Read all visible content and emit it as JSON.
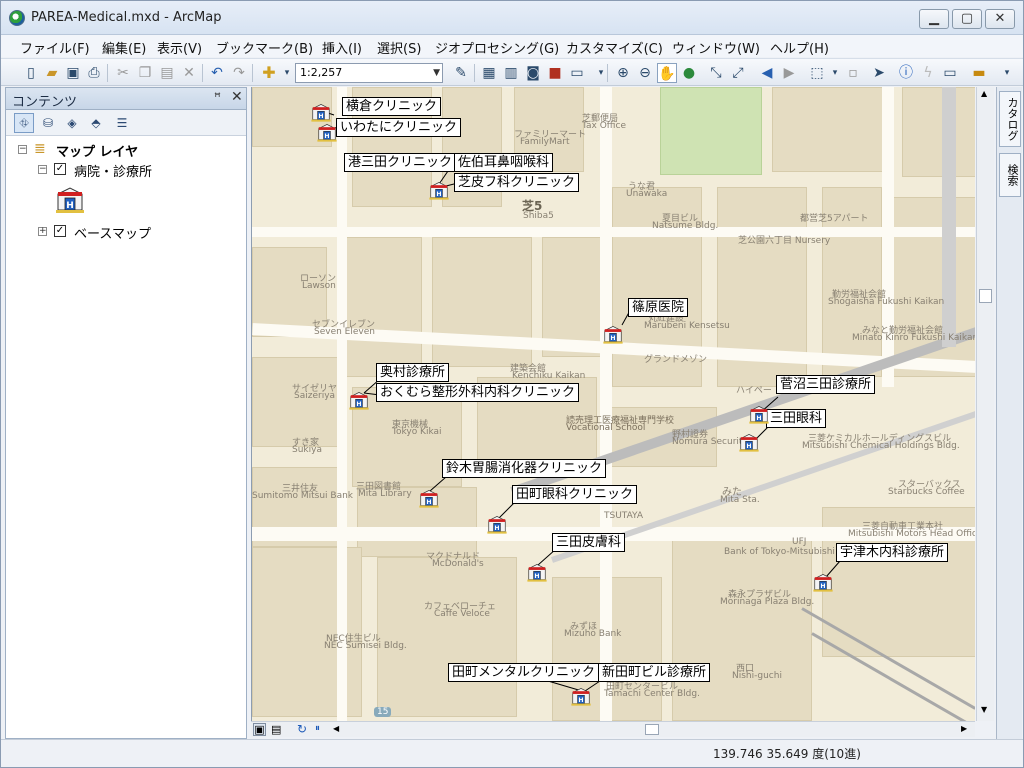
{
  "window": {
    "title": "PAREA-Medical.mxd - ArcMap",
    "minimize_glyph": "▁",
    "maximize_glyph": "▢",
    "close_glyph": "✕"
  },
  "menu": {
    "items": [
      "ファイル(F)",
      "編集(E)",
      "表示(V)",
      "ブックマーク(B)",
      "挿入(I)",
      "選択(S)",
      "ジオプロセシング(G)",
      "カスタマイズ(C)",
      "ウィンドウ(W)",
      "ヘルプ(H)"
    ]
  },
  "toolbar": {
    "scale": "1:2,257",
    "icons": [
      "new-document-icon",
      "open-folder-icon",
      "save-icon",
      "print-icon",
      "cut-icon",
      "copy-icon",
      "paste-icon",
      "delete-icon",
      "undo-icon",
      "redo-icon",
      "add-data-icon",
      "editor-toolbar-icon",
      "table-of-contents-icon",
      "catalog-icon",
      "search-window-icon",
      "arctoolbox-icon",
      "python-icon",
      "zoom-in-icon",
      "zoom-out-icon",
      "pan-icon",
      "full-extent-icon",
      "fixed-zoom-in-icon",
      "fixed-zoom-out-icon",
      "go-back-icon",
      "go-forward-icon",
      "select-features-icon",
      "clear-selection-icon",
      "select-elements-icon",
      "identify-icon",
      "hyperlink-icon",
      "html-popup-icon",
      "measure-icon"
    ]
  },
  "toc": {
    "title": "コンテンツ",
    "pin": "ꟸ",
    "close": "✕",
    "root_label": "マップ レイヤ",
    "layer1_label": "病院・診療所",
    "layer2_label": "ベースマップ",
    "check_glyph": "✓",
    "collapse_glyph": "−",
    "expand_glyph": "+"
  },
  "side_tabs": {
    "catalog": "カタログ",
    "search": "検索"
  },
  "map": {
    "features": [
      {
        "label": "横倉クリニック"
      },
      {
        "label": "いわたにクリニック"
      },
      {
        "label": "港三田クリニック"
      },
      {
        "label": "佐伯耳鼻咽喉科"
      },
      {
        "label": "芝皮フ科クリニック"
      },
      {
        "label": "篠原医院"
      },
      {
        "label": "奥村診療所"
      },
      {
        "label": "おくむら整形外科内科クリニック"
      },
      {
        "label": "菅沼三田診療所"
      },
      {
        "label": "三田眼科"
      },
      {
        "label": "鈴木胃腸消化器クリニック"
      },
      {
        "label": "田町眼科クリニック"
      },
      {
        "label": "三田皮膚科"
      },
      {
        "label": "宇津木内科診療所"
      },
      {
        "label": "田町メンタルクリニック"
      },
      {
        "label": "新田町ビル診療所"
      }
    ],
    "base_labels": [
      "芝郵便局",
      "Tax Office",
      "ファミリーマート",
      "FamilyMart",
      "芝5",
      "Shiba5",
      "うな君",
      "Unawaka",
      "夏目ビル",
      "Natsume Bldg.",
      "ローソン",
      "Lawson",
      "セブンイレブン",
      "Seven Eleven",
      "丸紅建設",
      "Marubeni Kensetsu",
      "グランドメゾン",
      "建築会館",
      "Kenchiku Kaikan",
      "読売理工医療福祉専門学校",
      "Vocational School",
      "東京機械",
      "Tokyo Kikai",
      "野村證券",
      "Nomura Securities",
      "三菱ケミカルホールディングスビル",
      "Mitsubishi Chemical Holdings Bldg.",
      "三田図書館",
      "Mita Library",
      "TSUTAYA",
      "みた",
      "Mita Sta.",
      "スターバックス",
      "Starbucks Coffee",
      "三菱自動車工業本社",
      "Mitsubishi Motors Head Office",
      "マクドナルド",
      "McDonald's",
      "カフェベローチェ",
      "Caffe Veloce",
      "みずほ",
      "Mizuho Bank",
      "森永プラザビル",
      "Morinaga Plaza Bldg.",
      "NEC住生ビル",
      "NEC Sumisei Bldg.",
      "田町センタービル",
      "Tamachi Center Bldg.",
      "西口",
      "Nishi-guchi",
      "芝公園六丁目 Nursery",
      "都営芝5アパート",
      "勤労福祉会館",
      "Shogaisha Fukushi Kaikan",
      "みなと勤労福祉会館",
      "Minato Kinro Fukushi Kaikan",
      "サイゼリヤ",
      "Saizeriya",
      "すき家",
      "Sukiya",
      "三井住友",
      "Sumitomo Mitsui Bank",
      "ハイペー",
      "UFJ",
      "Bank of Tokyo-Mitsubishi UFJ",
      "15"
    ]
  },
  "status": {
    "coords": "139.746  35.649 度(10進)"
  }
}
